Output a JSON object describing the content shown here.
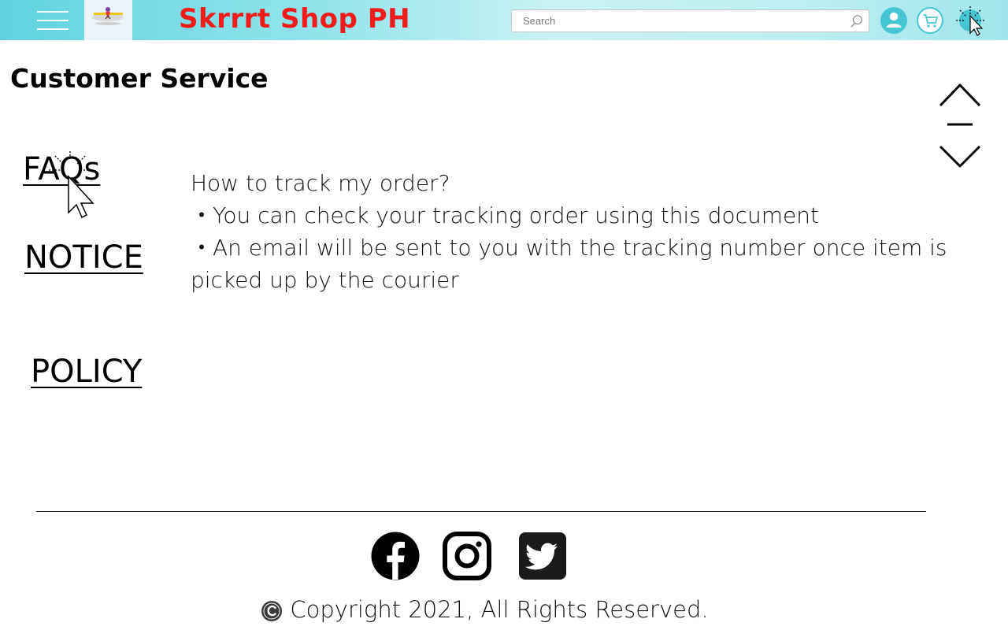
{
  "header": {
    "site_title": "Skrrrt Shop PH",
    "search_placeholder": "Search",
    "colors": {
      "title": "#ef1c1c",
      "icon": "#5fd3df"
    }
  },
  "page": {
    "title": "Customer Service"
  },
  "sidebar": {
    "links": [
      {
        "label": "FAQs"
      },
      {
        "label": "NOTICE"
      },
      {
        "label": "POLICY"
      }
    ]
  },
  "content": {
    "question": "How to track my order?",
    "bullets": [
      "・You can check your tracking order using this document",
      "・An email will be sent to you with the tracking number once item is picked up by the courier"
    ]
  },
  "footer": {
    "social": [
      "facebook-icon",
      "instagram-icon",
      "twitter-icon"
    ],
    "copyright": "Copyright 2021, All Rights Reserved."
  }
}
